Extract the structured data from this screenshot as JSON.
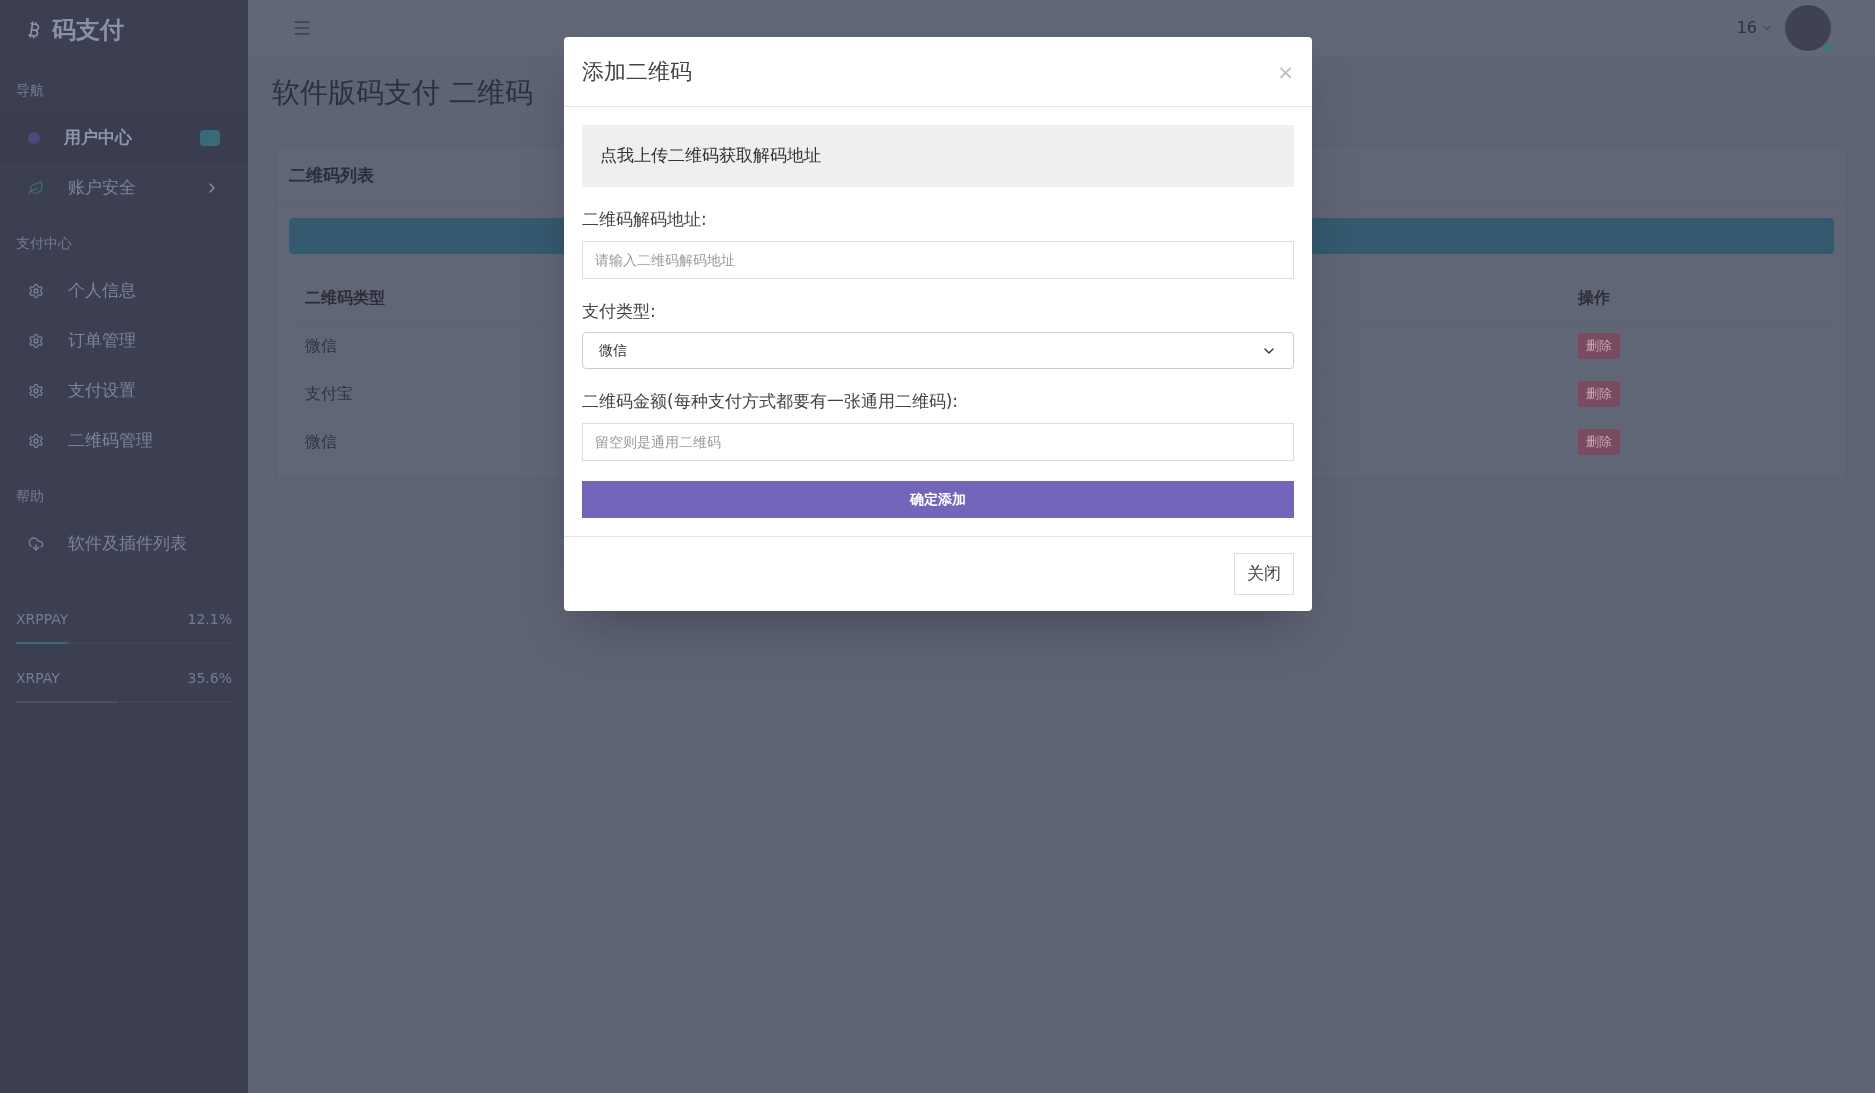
{
  "sidebar": {
    "brand": "码支付",
    "sections": [
      {
        "title": "导航",
        "items": [
          {
            "label": "用户中心",
            "kind": "dot",
            "selected": true,
            "badge": true,
            "expandable": false
          },
          {
            "label": "账户安全",
            "kind": "leaf",
            "selected": false,
            "badge": false,
            "expandable": true
          }
        ]
      },
      {
        "title": "支付中心",
        "items": [
          {
            "label": "个人信息",
            "kind": "gear",
            "selected": false,
            "badge": false,
            "expandable": false
          },
          {
            "label": "订单管理",
            "kind": "gear",
            "selected": false,
            "badge": false,
            "expandable": false
          },
          {
            "label": "支付设置",
            "kind": "gear",
            "selected": false,
            "badge": false,
            "expandable": false
          },
          {
            "label": "二维码管理",
            "kind": "gear",
            "selected": false,
            "badge": false,
            "expandable": false
          }
        ]
      },
      {
        "title": "帮助",
        "items": [
          {
            "label": "软件及插件列表",
            "kind": "cloud",
            "selected": false,
            "badge": false,
            "expandable": false
          }
        ]
      }
    ],
    "progress": [
      {
        "label": "XRPPAY",
        "value": "12.1%",
        "level": 0.24
      },
      {
        "label": "XRPAY",
        "value": "35.6%",
        "level": 0.47
      }
    ]
  },
  "header": {
    "user": "16"
  },
  "page": {
    "title": "软件版码支付 二维码",
    "card_title": "二维码列表",
    "table": {
      "columns": [
        "二维码类型",
        "操作"
      ],
      "rows": [
        {
          "type": "微信",
          "action": "删除"
        },
        {
          "type": "支付宝",
          "action": "删除"
        },
        {
          "type": "微信",
          "action": "删除"
        }
      ]
    }
  },
  "modal": {
    "title": "添加二维码",
    "close": "×",
    "upload": "点我上传二维码获取解码地址",
    "fields": [
      {
        "kind": "input",
        "label": "二维码解码地址:",
        "placeholder": "请输入二维码解码地址"
      },
      {
        "kind": "select",
        "label": "支付类型:",
        "value": "微信"
      },
      {
        "kind": "input",
        "label": "二维码金额(每种支付方式都要有一张通用二维码):",
        "placeholder": "留空则是通用二维码"
      }
    ],
    "submit": "确定添加",
    "footer_button": "关闭"
  }
}
